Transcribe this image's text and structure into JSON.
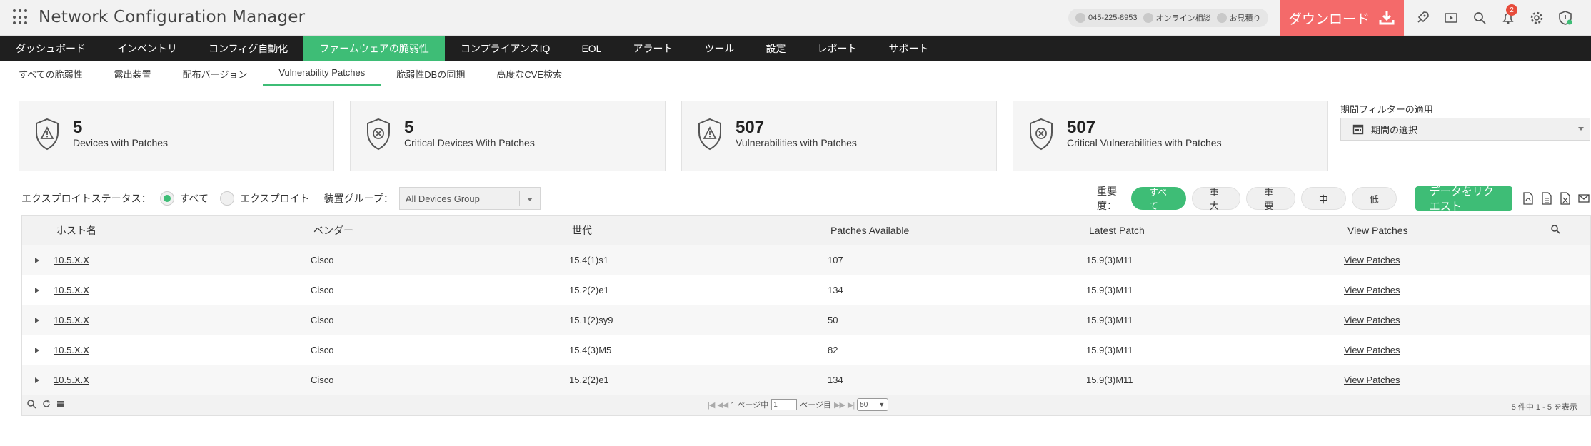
{
  "app": {
    "title": "Network Configuration Manager"
  },
  "contact": {
    "phone": "045-225-8953",
    "online": "オンライン相談",
    "quote": "お見積り"
  },
  "download": {
    "label": "ダウンロード"
  },
  "notifications": {
    "count": "2"
  },
  "colors": {
    "accent": "#3ebd76",
    "download": "#f46a6a",
    "nav_bg": "#1f1f1f"
  },
  "main_nav": [
    {
      "label": "ダッシュボード"
    },
    {
      "label": "インベントリ"
    },
    {
      "label": "コンフィグ自動化"
    },
    {
      "label": "ファームウェアの脆弱性",
      "active": true
    },
    {
      "label": "コンプライアンスIQ"
    },
    {
      "label": "EOL"
    },
    {
      "label": "アラート"
    },
    {
      "label": "ツール"
    },
    {
      "label": "設定"
    },
    {
      "label": "レポート"
    },
    {
      "label": "サポート"
    }
  ],
  "sub_nav": [
    {
      "label": "すべての脆弱性"
    },
    {
      "label": "露出装置"
    },
    {
      "label": "配布バージョン"
    },
    {
      "label": "Vulnerability Patches",
      "active": true
    },
    {
      "label": "脆弱性DBの同期"
    },
    {
      "label": "高度なCVE検索"
    }
  ],
  "cards": [
    {
      "value": "5",
      "label": "Devices with Patches",
      "icon": "warning-shield-icon"
    },
    {
      "value": "5",
      "label": "Critical Devices With Patches",
      "icon": "critical-shield-icon"
    },
    {
      "value": "507",
      "label": "Vulnerabilities with Patches",
      "icon": "warning-shield-icon"
    },
    {
      "value": "507",
      "label": "Critical Vulnerabilities with Patches",
      "icon": "critical-shield-icon"
    }
  ],
  "period_filter": {
    "label": "期間フィルターの適用",
    "value": "期間の選択"
  },
  "filters": {
    "exploit_status_label": "エクスプロイトステータス：",
    "option_all": "すべて",
    "option_exploit": "エクスプロイト",
    "selected": "すべて",
    "device_group_label": "装置グループ：",
    "device_group_value": "All Devices Group"
  },
  "severity": {
    "label": "重要度：",
    "options": [
      "すべて",
      "重大",
      "重要",
      "中",
      "低"
    ],
    "selected": "すべて"
  },
  "request_button": {
    "label": "データをリクエスト"
  },
  "table": {
    "columns": [
      "ホスト名",
      "ベンダー",
      "世代",
      "Patches Available",
      "Latest Patch",
      "View Patches"
    ],
    "rows": [
      {
        "host": "10.5.X.X",
        "vendor": "Cisco",
        "generation": "15.4(1)s1",
        "patches": "107",
        "latest": "15.9(3)M11",
        "view": "View Patches"
      },
      {
        "host": "10.5.X.X",
        "vendor": "Cisco",
        "generation": "15.2(2)e1",
        "patches": "134",
        "latest": "15.9(3)M11",
        "view": "View Patches"
      },
      {
        "host": "10.5.X.X",
        "vendor": "Cisco",
        "generation": "15.1(2)sy9",
        "patches": "50",
        "latest": "15.9(3)M11",
        "view": "View Patches"
      },
      {
        "host": "10.5.X.X",
        "vendor": "Cisco",
        "generation": "15.4(3)M5",
        "patches": "82",
        "latest": "15.9(3)M11",
        "view": "View Patches"
      },
      {
        "host": "10.5.X.X",
        "vendor": "Cisco",
        "generation": "15.2(2)e1",
        "patches": "134",
        "latest": "15.9(3)M11",
        "view": "View Patches"
      }
    ]
  },
  "pagination": {
    "page_prefix": "1 ページ中",
    "page_value": "1",
    "page_suffix": "ページ目",
    "page_size": "50",
    "range_text": "5 件中 1 - 5 を表示"
  }
}
